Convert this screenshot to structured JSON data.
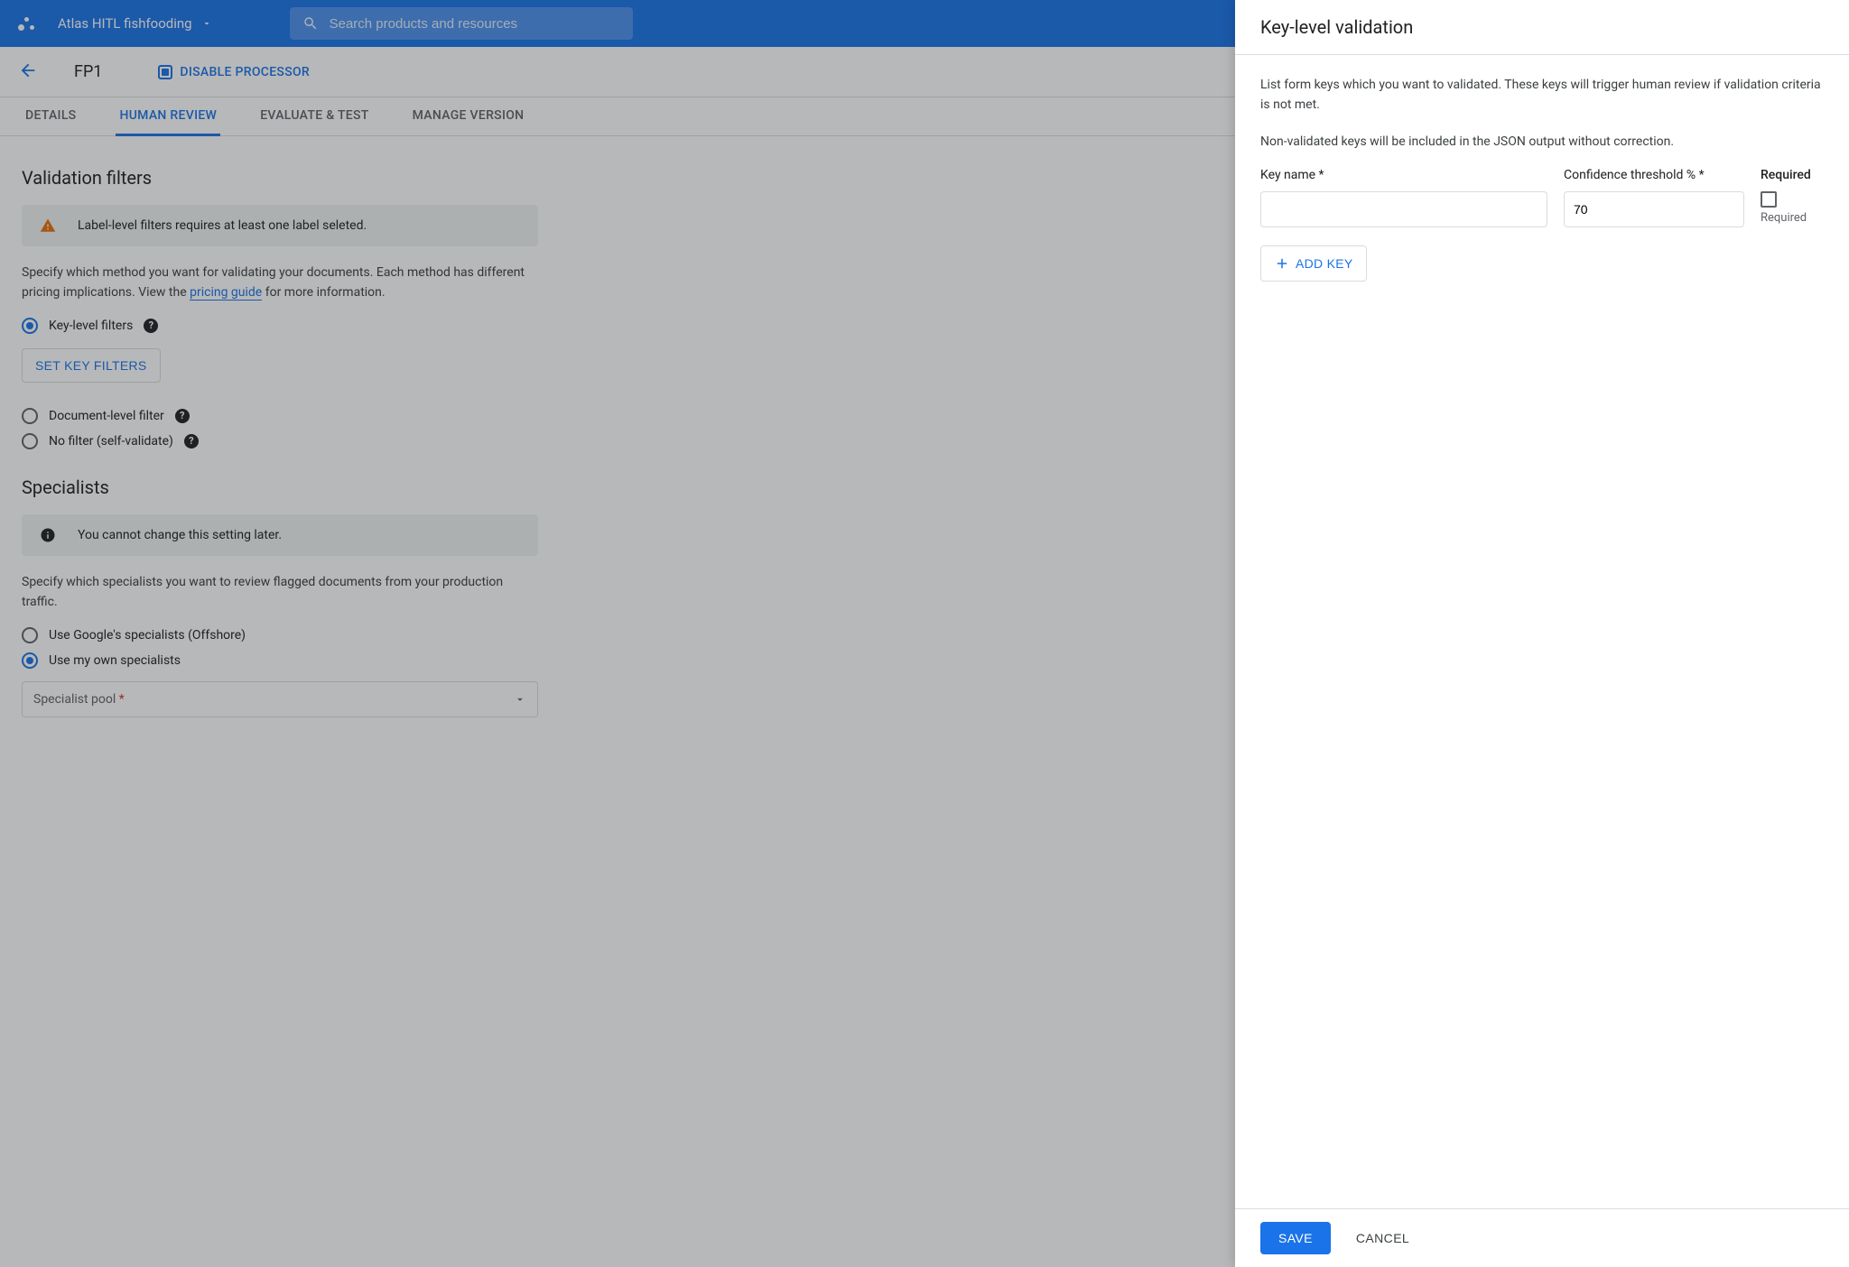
{
  "topbar": {
    "project_name": "Atlas HITL fishfooding",
    "search_placeholder": "Search products and resources"
  },
  "subbar": {
    "processor_name": "FP1",
    "disable_label": "DISABLE PROCESSOR"
  },
  "tabs": {
    "details": "DETAILS",
    "human_review": "HUMAN REVIEW",
    "evaluate_test": "EVALUATE & TEST",
    "manage_versions": "MANAGE VERSION"
  },
  "validation": {
    "heading": "Validation filters",
    "warning": "Label-level filters requires at least one label seleted.",
    "description_1": "Specify which method you want for validating your documents. Each method has different pricing implications. View the ",
    "pricing_link": "pricing guide",
    "description_2": " for more information.",
    "radio_key": "Key-level filters",
    "set_filters_btn": "SET KEY FILTERS",
    "radio_document": "Document-level filter",
    "radio_none": "No filter (self-validate)"
  },
  "specialists": {
    "heading": "Specialists",
    "info": "You cannot change this setting later.",
    "description": "Specify which specialists you want to review flagged documents from your production traffic.",
    "radio_google": "Use Google's specialists (Offshore)",
    "radio_own": "Use my own specialists",
    "select_placeholder": "Specialist pool",
    "select_required_marker": " *"
  },
  "panel": {
    "title": "Key-level validation",
    "intro_1": "List form keys which you want to validated. These keys will trigger human review if validation criteria is not met.",
    "intro_2": "Non-validated keys will be included in the JSON output without correction.",
    "key_name_label": "Key name *",
    "confidence_label": "Confidence threshold % *",
    "confidence_value": "70",
    "required_header": "Required",
    "required_sub": "Required",
    "add_key_btn": "ADD KEY",
    "save_btn": "SAVE",
    "cancel_btn": "CANCEL"
  }
}
